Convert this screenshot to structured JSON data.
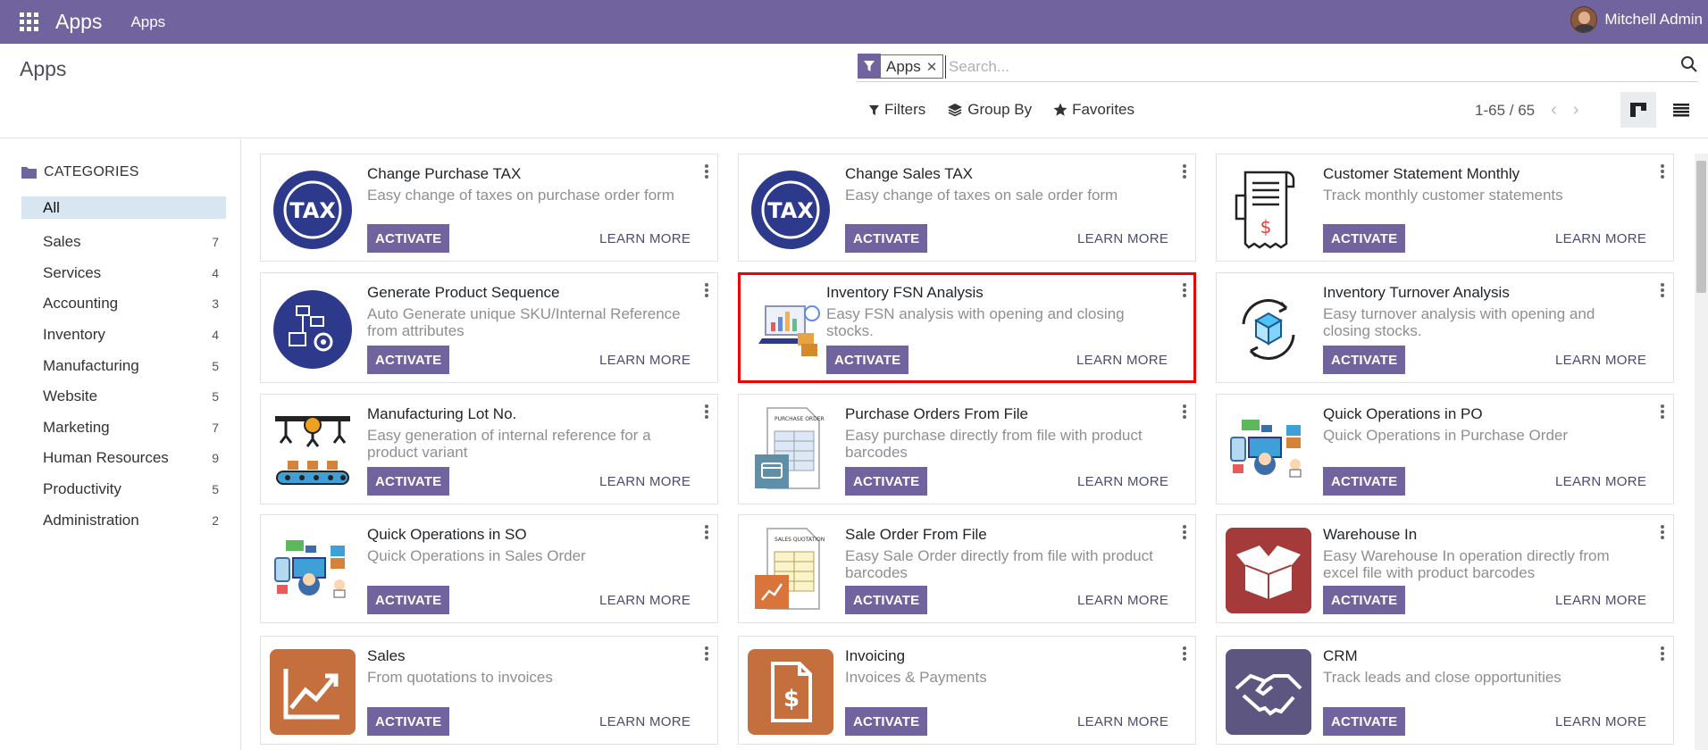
{
  "navbar": {
    "brand": "Apps",
    "menu": "Apps",
    "user": "Mitchell Admin",
    "color": "#71639e"
  },
  "control": {
    "title": "Apps",
    "facet": "Apps",
    "search_placeholder": "Search...",
    "filters": "Filters",
    "group_by": "Group By",
    "favorites": "Favorites",
    "pager": "1-65 / 65"
  },
  "sidebar": {
    "header": "CATEGORIES",
    "items": [
      {
        "label": "All",
        "count": ""
      },
      {
        "label": "Sales",
        "count": "7"
      },
      {
        "label": "Services",
        "count": "4"
      },
      {
        "label": "Accounting",
        "count": "3"
      },
      {
        "label": "Inventory",
        "count": "4"
      },
      {
        "label": "Manufacturing",
        "count": "5"
      },
      {
        "label": "Website",
        "count": "5"
      },
      {
        "label": "Marketing",
        "count": "7"
      },
      {
        "label": "Human Resources",
        "count": "9"
      },
      {
        "label": "Productivity",
        "count": "5"
      },
      {
        "label": "Administration",
        "count": "2"
      }
    ]
  },
  "buttons": {
    "activate": "ACTIVATE",
    "learn_more": "LEARN MORE"
  },
  "apps": [
    {
      "name": "Change Purchase TAX",
      "desc": "Easy change of taxes on purchase order form",
      "icon": "tax-icon"
    },
    {
      "name": "Change Sales TAX",
      "desc": "Easy change of taxes on sale order form",
      "icon": "tax-icon"
    },
    {
      "name": "Customer Statement Monthly",
      "desc": "Track monthly customer statements",
      "icon": "receipt-icon"
    },
    {
      "name": "Generate Product Sequence",
      "desc": "Auto Generate unique SKU/Internal Reference from attributes",
      "icon": "sequence-icon"
    },
    {
      "name": "Inventory FSN Analysis",
      "desc": "Easy FSN analysis with opening and closing stocks.",
      "icon": "analysis-icon"
    },
    {
      "name": "Inventory Turnover Analysis",
      "desc": "Easy turnover analysis with opening and closing stocks.",
      "icon": "turnover-icon"
    },
    {
      "name": "Manufacturing Lot No.",
      "desc": "Easy generation of internal reference for a product variant",
      "icon": "factory-icon"
    },
    {
      "name": "Purchase Orders From File",
      "desc": "Easy purchase directly from file with product barcodes",
      "icon": "purchase-file-icon"
    },
    {
      "name": "Quick Operations in PO",
      "desc": "Quick Operations in Purchase Order",
      "icon": "quick-ops-icon"
    },
    {
      "name": "Quick Operations in SO",
      "desc": "Quick Operations in Sales Order",
      "icon": "quick-ops-icon"
    },
    {
      "name": "Sale Order From File",
      "desc": "Easy Sale Order directly from file with product barcodes",
      "icon": "sales-file-icon"
    },
    {
      "name": "Warehouse In",
      "desc": "Easy Warehouse In operation directly from excel file with product barcodes",
      "icon": "warehouse-icon"
    },
    {
      "name": "Sales",
      "desc": "From quotations to invoices",
      "icon": "sales-chart-icon"
    },
    {
      "name": "Invoicing",
      "desc": "Invoices & Payments",
      "icon": "invoice-icon"
    },
    {
      "name": "CRM",
      "desc": "Track leads and close opportunities",
      "icon": "handshake-icon"
    }
  ],
  "icon_text": {
    "tax": "TAX",
    "purchase_doc": "PURCHASE ORDER",
    "sales_doc": "SALES QUOTATION"
  }
}
